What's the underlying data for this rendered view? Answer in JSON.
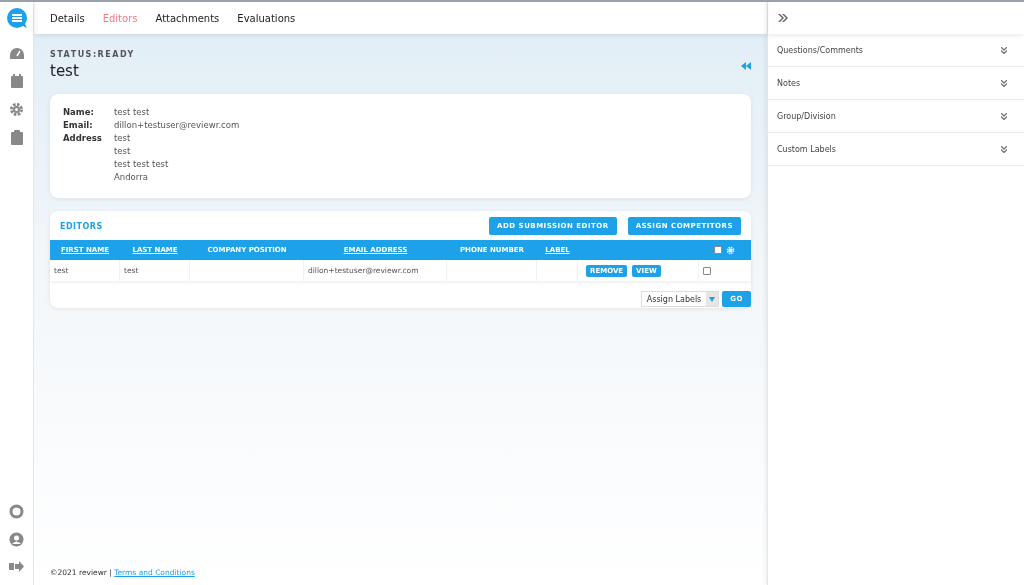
{
  "tabs": [
    {
      "label": "Details",
      "selected": false
    },
    {
      "label": "Editors",
      "selected": true
    },
    {
      "label": "Attachments",
      "selected": false
    },
    {
      "label": "Evaluations",
      "selected": false
    }
  ],
  "status": "STATUS:READY",
  "title": "test",
  "profile": [
    {
      "label": "Name:",
      "lines": [
        "test test"
      ]
    },
    {
      "label": "Email:",
      "lines": [
        "dillon+testuser@reviewr.com"
      ]
    },
    {
      "label": "Address",
      "lines": [
        "test",
        "test",
        "test test test",
        "Andorra"
      ]
    }
  ],
  "editors": {
    "title": "EDITORS",
    "buttons": [
      "ADD SUBMISSION EDITOR",
      "ASSIGN COMPETITORS"
    ],
    "columns": [
      {
        "label": "FIRST NAME",
        "sortable": true
      },
      {
        "label": "LAST NAME",
        "sortable": true
      },
      {
        "label": "COMPANY POSITION",
        "sortable": false
      },
      {
        "label": "EMAIL ADDRESS",
        "sortable": true
      },
      {
        "label": "PHONE NUMBER",
        "sortable": false
      },
      {
        "label": "LABEL",
        "sortable": true
      }
    ],
    "select_all_checked": false,
    "rows": [
      {
        "cells": [
          "test",
          "test",
          "",
          "dillon+testuser@reviewr.com",
          "",
          ""
        ],
        "actions": [
          "REMOVE",
          "VIEW"
        ],
        "checked": false
      }
    ],
    "bulk_select": "Assign Labels",
    "go": "GO"
  },
  "panel": {
    "items": [
      "Questions/Comments",
      "Notes",
      "Group/Division",
      "Custom Labels"
    ]
  },
  "footer": {
    "copyright": "©2021 reviewr |",
    "link": "Terms and Conditions"
  }
}
